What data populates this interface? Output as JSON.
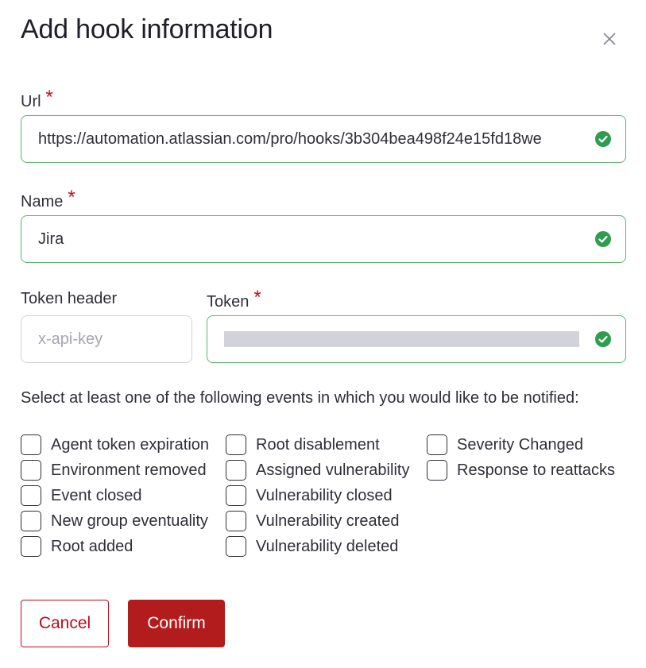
{
  "dialog": {
    "title": "Add hook information"
  },
  "url_field": {
    "label": "Url",
    "required_mark": "*",
    "value": "https://automation.atlassian.com/pro/hooks/3b304bea498f24e15fd18we"
  },
  "name_field": {
    "label": "Name",
    "required_mark": "*",
    "value": "Jira"
  },
  "token_header_field": {
    "label": "Token header",
    "placeholder": "x-api-key"
  },
  "token_field": {
    "label": "Token",
    "required_mark": "*"
  },
  "events": {
    "prompt": "Select at least one of the following events in which you would like to be notified:",
    "column1": [
      "Agent token expiration",
      "Environment removed",
      "Event closed",
      "New group eventuality",
      "Root added"
    ],
    "column2": [
      "Root disablement",
      "Assigned vulnerability",
      "Vulnerability closed",
      "Vulnerability created",
      "Vulnerability deleted"
    ],
    "column3": [
      "Severity Changed",
      "Response to reattacks"
    ]
  },
  "buttons": {
    "cancel": "Cancel",
    "confirm": "Confirm"
  },
  "colors": {
    "accent": "#bf0b1a",
    "valid_border": "#5ab56d",
    "valid_icon": "#2e9d4f"
  },
  "icons": {
    "close": "close-icon",
    "valid": "check-circle-icon"
  }
}
